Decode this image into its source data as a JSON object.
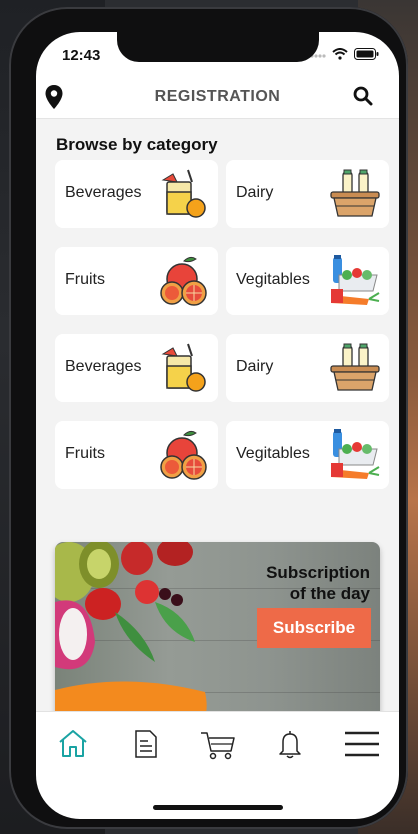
{
  "status_bar": {
    "time": "12:43"
  },
  "header": {
    "title": "REGISTRATION",
    "left_icon": "location-pin-icon",
    "right_icon": "search-icon"
  },
  "browse": {
    "title": "Browse by category",
    "categories": [
      {
        "label": "Beverages",
        "icon": "juice-icon"
      },
      {
        "label": "Dairy",
        "icon": "dairy-basket-icon"
      },
      {
        "label": "Fruits",
        "icon": "fruits-icon"
      },
      {
        "label": "Vegitables",
        "icon": "vegetables-icon"
      },
      {
        "label": "Beverages",
        "icon": "juice-icon"
      },
      {
        "label": "Dairy",
        "icon": "dairy-basket-icon"
      },
      {
        "label": "Fruits",
        "icon": "fruits-icon"
      },
      {
        "label": "Vegitables",
        "icon": "vegetables-icon"
      }
    ]
  },
  "banner": {
    "title_line1": "Subscription",
    "title_line2": "of the day",
    "button_label": "Subscribe"
  },
  "tabbar": {
    "items": [
      "home-icon",
      "document-icon",
      "cart-icon",
      "bell-icon",
      "menu-icon"
    ],
    "active_color": "#1aa3a3"
  },
  "colors": {
    "accent": "#ee6a48",
    "active_tab": "#1aa3a3"
  }
}
